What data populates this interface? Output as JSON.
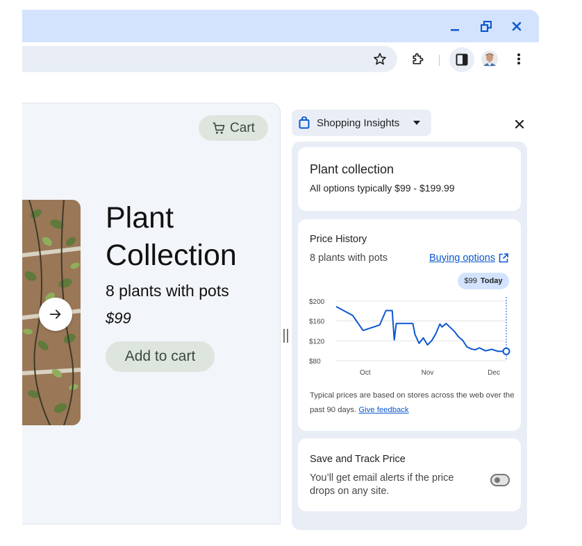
{
  "window": {
    "minimize_icon": "minimize-icon",
    "restore_icon": "restore-icon",
    "close_icon": "close-icon"
  },
  "toolbar": {
    "icons": [
      "star-icon",
      "extensions-icon",
      "side-panel-icon",
      "profile-avatar",
      "more-menu-icon"
    ]
  },
  "page": {
    "cart_label": "Cart",
    "title_line1": "Plant",
    "title_line2": "Collection",
    "subtitle": "8 plants with pots",
    "price": "$99",
    "add_to_cart_label": "Add to cart"
  },
  "side_panel": {
    "title": "Shopping Insights",
    "summary": {
      "title": "Plant collection",
      "range": "All options typically $99 - $199.99"
    },
    "price_history": {
      "title": "Price History",
      "subtitle": "8 plants with pots",
      "buying_options_label": "Buying options",
      "today_price": "$99",
      "today_label": "Today",
      "note_text": "Typical prices are based on stores across the web over the past 90 days.",
      "feedback_link": "Give feedback"
    },
    "track": {
      "title": "Save and Track Price",
      "description": "You’ll get email alerts if the price drops on any site.",
      "toggle_on": false
    }
  },
  "colors": {
    "accent": "#0b57d0",
    "titlebar": "#d3e3fd",
    "panel_bg": "#e9eef6",
    "button_green": "#dde5de"
  },
  "chart_data": {
    "type": "line",
    "y_tick_labels": [
      "$200",
      "$160",
      "$120",
      "$80"
    ],
    "y_ticks": [
      200,
      160,
      120,
      80
    ],
    "ylim": [
      80,
      200
    ],
    "x_tick_labels": [
      "Oct",
      "Nov",
      "Dec"
    ],
    "x_tick_positions": [
      14,
      44,
      76
    ],
    "xlim": [
      0,
      82
    ],
    "grid": true,
    "series": [
      {
        "x": [
          0,
          8,
          13,
          21,
          24,
          27,
          28,
          29,
          30,
          37,
          38,
          40,
          42,
          44,
          46,
          48,
          50,
          51,
          53,
          57,
          59,
          61,
          63,
          65,
          67,
          69,
          72,
          75,
          78,
          82
        ],
        "values": [
          189,
          171,
          141,
          152,
          181,
          181,
          122,
          155,
          155,
          155,
          133,
          115,
          126,
          112,
          120,
          134,
          154,
          148,
          155,
          139,
          128,
          121,
          108,
          104,
          102,
          106,
          100,
          103,
          99,
          99
        ]
      }
    ]
  }
}
